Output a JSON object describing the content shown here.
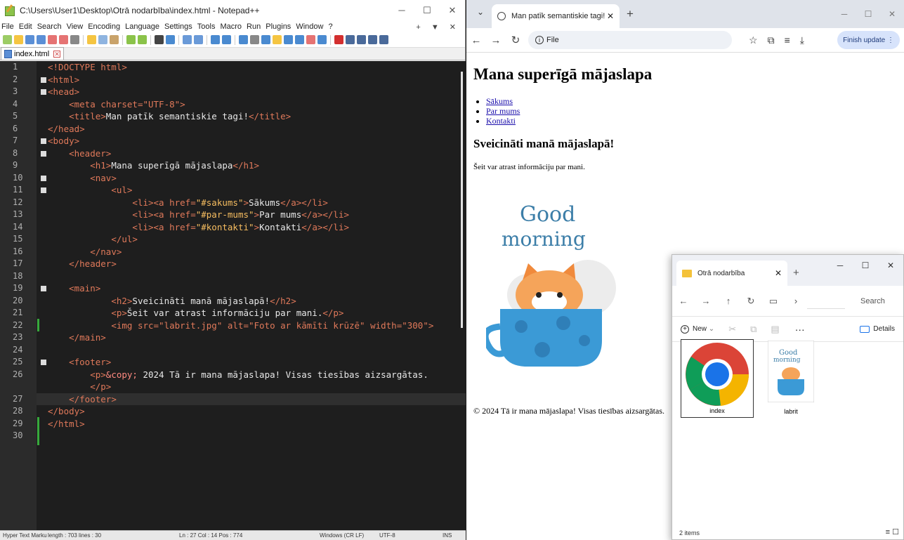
{
  "notepad": {
    "title": "C:\\Users\\User1\\Desktop\\Otrā nodarbība\\index.html - Notepad++",
    "menu": [
      "File",
      "Edit",
      "Search",
      "View",
      "Encoding",
      "Language",
      "Settings",
      "Tools",
      "Macro",
      "Run",
      "Plugins",
      "Window",
      "?"
    ],
    "menu_right": "+ ▼ ✕",
    "tab_label": "index.html",
    "line_numbers": [
      "1",
      "2",
      "3",
      "4",
      "5",
      "6",
      "7",
      "8",
      "9",
      "10",
      "11",
      "12",
      "13",
      "14",
      "15",
      "16",
      "17",
      "18",
      "19",
      "20",
      "21",
      "22",
      "23",
      "24",
      "25",
      "26",
      "",
      "27",
      "28",
      "29",
      "30"
    ],
    "status": {
      "type": "Hyper Text Marku",
      "length": "length : 703   lines : 30",
      "position": "Ln : 27   Col : 14   Pos : 774",
      "eol": "Windows (CR LF)",
      "encoding": "UTF-8",
      "mode": "INS"
    },
    "code": {
      "l1": "<!DOCTYPE html>",
      "l4_meta": "<meta charset=\"UTF-8\">",
      "l5_open": "<title>",
      "l5_text": "Man patīk semantiskie tagi!",
      "l5_close": "</title>",
      "l9_text": "Mana superīgā mājaslapa",
      "l12_text": "Sākums",
      "l13_text": "Par mums",
      "l14_text": "Kontakti",
      "l20_text": "Sveicināti manā mājaslapā!",
      "l21_text": "Šeit var atrast informāciju par mani.",
      "l22": "<img src=\"labrit.jpg\" alt=\"Foto ar kāmīti krūzē\" width=\"300\">",
      "l26_entity": "&copy;",
      "l26_text": " 2024 Tā ir mana mājaslapa! Visas tiesības aizsargātas."
    }
  },
  "browser": {
    "tab_title": "Man patīk semantiskie tagi!",
    "address": "File",
    "finish_update": "Finish update",
    "page": {
      "h1": "Mana superīgā mājaslapa",
      "nav": [
        "Sākums",
        "Par mums",
        "Kontakti"
      ],
      "h2": "Sveicināti manā mājaslapā!",
      "para": "Šeit var atrast informāciju par mani.",
      "image_text_top": "Good",
      "image_text_bottom": "morning",
      "footer": "© 2024 Tā ir mana mājaslapa! Visas tiesības aizsargātas."
    }
  },
  "explorer": {
    "tab_title": "Otrā nodarbība",
    "new_label": "New",
    "details_label": "Details",
    "search_label": "Search",
    "files": [
      {
        "name": "index"
      },
      {
        "name": "labrit"
      }
    ],
    "status": "2 items",
    "thumb_top": "Good",
    "thumb_bottom": "morning"
  },
  "colors": {
    "tag": "#e0795a",
    "value": "#f6bd60",
    "editor_bg": "#1e1e1e",
    "chrome_blue": "#1a73e8"
  }
}
